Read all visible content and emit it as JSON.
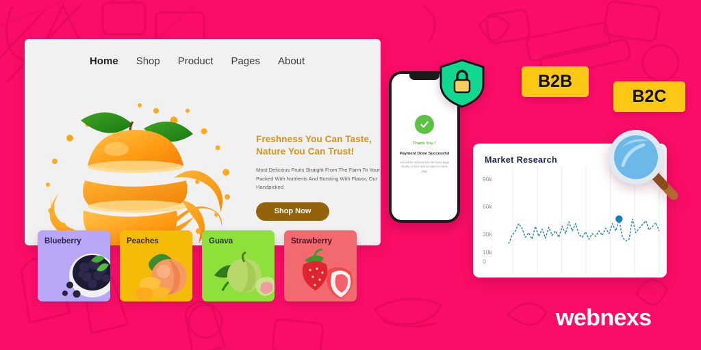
{
  "background": {
    "color": "#fa0d68",
    "pattern": "ecommerce-outline-watermarks"
  },
  "site_card": {
    "nav": [
      {
        "label": "Home",
        "active": true
      },
      {
        "label": "Shop",
        "active": false
      },
      {
        "label": "Product",
        "active": false
      },
      {
        "label": "Pages",
        "active": false
      },
      {
        "label": "About",
        "active": false
      }
    ],
    "hero": {
      "image_alt": "sliced-orange-juice-splash",
      "title_line1": "Freshness You Can Taste,",
      "title_line2": "Nature You Can Trust!",
      "title_color": "#d89217",
      "paragraph": "Most Delicious Fruits Straight From The Farm To Your Table, Packed With Nutrients And Bursting With Flavor, Our Handpicked",
      "cta_label": "Shop Now",
      "cta_color": "#94620b"
    },
    "fruit_cards": [
      {
        "name": "Blueberry",
        "bg": "#b9a6f7",
        "text_color": "#2c2350",
        "image_alt": "bowl-of-blueberries"
      },
      {
        "name": "Peaches",
        "bg": "#f5bc07",
        "text_color": "#3a2a05",
        "image_alt": "peaches-and-slices"
      },
      {
        "name": "Guava",
        "bg": "#8fe03a",
        "text_color": "#1f3a08",
        "image_alt": "guava-whole-and-half"
      },
      {
        "name": "Strawberry",
        "bg": "#f26a70",
        "text_color": "#52141a",
        "image_alt": "strawberries-whole-and-half"
      }
    ]
  },
  "phone": {
    "status_alt": "phone-notch",
    "check_icon": "check-circle-icon",
    "thanks_text": "Thank You !",
    "payment_title": "Payment Done Successful",
    "payment_sub": "You will be redirected to the home page shortly or click here to return to home page"
  },
  "shield": {
    "icon": "shield-lock-icon",
    "shield_color": "#10d88f",
    "lock_color": "#f7cd5d"
  },
  "badges": [
    {
      "label": "B2B",
      "bg": "#fcc816",
      "text_color": "#111111"
    },
    {
      "label": "B2C",
      "bg": "#fcc816",
      "text_color": "#111111"
    }
  ],
  "magnifier": {
    "icon": "magnifying-glass-icon",
    "lens_color": "#6cb8e8",
    "handle_color": "#b2682e"
  },
  "logo": {
    "text": "webnexs",
    "color": "#ffffff"
  },
  "chart_data": {
    "type": "line",
    "title": "Market Research",
    "xlabel": "",
    "ylabel": "",
    "ytick_labels": [
      "90k",
      "60k",
      "30k",
      "10k",
      "0"
    ],
    "ytick_positions": [
      90,
      60,
      30,
      10,
      0
    ],
    "ylim": [
      0,
      100
    ],
    "grid": "vertical-only",
    "legend": "none",
    "line_color": "#2f86b8",
    "line_style": "dashed",
    "marker": {
      "index": 33,
      "value": 46,
      "color": "#1a7cb5",
      "label": ""
    },
    "values": [
      19,
      28,
      33,
      41,
      36,
      26,
      31,
      24,
      38,
      27,
      35,
      25,
      37,
      28,
      33,
      26,
      38,
      30,
      43,
      33,
      41,
      29,
      26,
      32,
      24,
      30,
      27,
      33,
      28,
      36,
      30,
      41,
      33,
      46,
      26,
      22,
      24,
      46,
      31,
      36,
      40,
      44,
      34,
      38,
      42,
      33
    ]
  }
}
